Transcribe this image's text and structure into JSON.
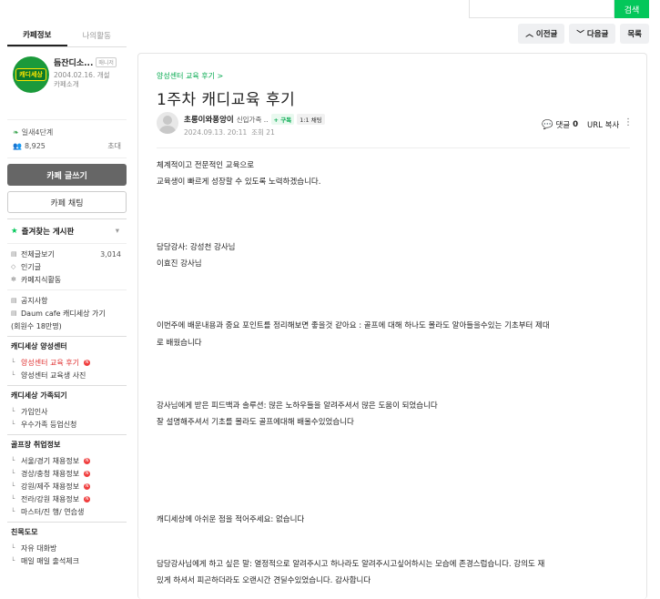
{
  "topbar": {
    "search_placeholder": "",
    "search_button": "검색"
  },
  "sidebar": {
    "tabs": [
      "카페정보",
      "나의활동"
    ],
    "cafe": {
      "logo_text": "캐디세상",
      "name": "듬잔디소...",
      "manager_badge": "매니저",
      "since": "2004.02.16. 개설",
      "intro": "카페소개"
    },
    "level": "일새4단계",
    "members": "8,925",
    "invite": "초대",
    "write_button": "카페 글쓰기",
    "chat_button": "카페 채팅",
    "favorites": "즐겨찾는 게시판",
    "menu1": [
      {
        "label": "전체글보기",
        "count": "3,014"
      },
      {
        "label": "인기글",
        "count": ""
      },
      {
        "label": "카페지식활동",
        "count": ""
      }
    ],
    "menu2": [
      {
        "label": "공지사항"
      },
      {
        "label": "Daum cafe 캐디세상 가기"
      },
      {
        "label": "(회원수 18만명)"
      }
    ],
    "group1": "캐디세상 양성센터",
    "group1_items": [
      {
        "label": "양성센터 교육 후기"
      },
      {
        "label": "양성센터 교육생 사진"
      }
    ],
    "group2": "캐디세상 가족되기",
    "group2_items": [
      {
        "label": "가입인사"
      },
      {
        "label": "우수가족 등업신청"
      }
    ],
    "group3": "골프장 취업정보",
    "group3_items": [
      {
        "label": "서울/경기 채용정보"
      },
      {
        "label": "경상/충청 채용정보"
      },
      {
        "label": "강원/제주 채용정보"
      },
      {
        "label": "전라/강원 채용정보"
      },
      {
        "label": "마스터/진 행/ 연습생"
      }
    ],
    "group4": "친목도모",
    "group4_items": [
      {
        "label": "자유 대화방"
      },
      {
        "label": "매일 매일 출석체크"
      }
    ]
  },
  "nav": {
    "prev": "이전글",
    "next": "다음글",
    "list": "목록"
  },
  "post": {
    "breadcrumb": "양성센터 교육 후기 >",
    "title": "1주차 캐디교육 후기",
    "author": "초롱이와퐁앙이",
    "grade": "신입가족 ..",
    "follow": "+ 구독",
    "chat": "1:1 채팅",
    "date": "2024.09.13. 20:11",
    "views": "조회 21",
    "comments_label": "댓글",
    "comments_count": "0",
    "url_copy": "URL 복사",
    "paragraphs": [
      "체계적이고 전문적인 교육으로",
      "교육생이 빠르게 성장할 수 있도록 노력하겠습니다.",
      "담당강사:  강성천 강사님",
      "이효진 강사님",
      "이번주에 배운내용과 중요 포인트를 정리해보면 좋을것 같아요 :  골프에 대해 하나도 몰라도 알아들을수있는 기초부터 제대",
      "로 배웠습니다",
      "강사님에게 받은 피드백과 솔루션: 많은 노하우들을 알려주셔서 많은 도움이 되었습니다",
      "잘 설명해주셔서 기초를 몰라도 골프에대해  배울수있었습니다",
      "캐디세상에 아쉬운 점을 적어주세요: 없습니다",
      "담당강사님에게 하고 싶은 말: 열정적으로 알려주시고 하나라도 알려주시고싶어하시는 모습에 존경스럽습니다. 강의도 재",
      "밌게 하셔서 피곤하더라도 오랜시간 견딜수있었습니다. 감사합니다"
    ]
  }
}
